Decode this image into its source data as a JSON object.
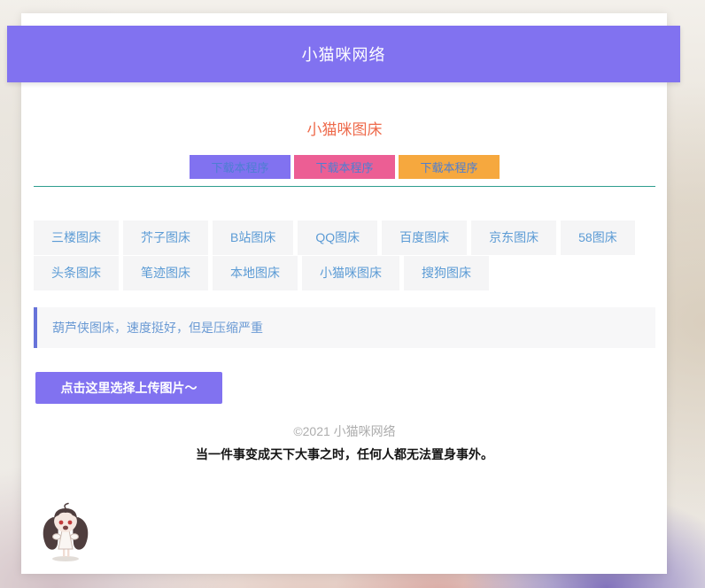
{
  "header": {
    "title": "小猫咪网络"
  },
  "main": {
    "title": "小猫咪图床",
    "download_buttons": [
      {
        "label": "下载本程序",
        "bg": "#8172f0"
      },
      {
        "label": "下载本程序",
        "bg": "#ec5e94"
      },
      {
        "label": "下载本程序",
        "bg": "#f6a83e"
      }
    ],
    "tabs": [
      "三楼图床",
      "芥子图床",
      "B站图床",
      "QQ图床",
      "百度图床",
      "京东图床",
      "58图床",
      "头条图床",
      "笔迹图床",
      "本地图床",
      "小猫咪图床",
      "搜狗图床"
    ],
    "notice": "葫芦侠图床，速度挺好，但是压缩严重",
    "upload_button": "点击这里选择上传图片～"
  },
  "footer": {
    "copyright": "©2021 小猫咪网络",
    "quote": "当一件事变成天下大事之时，任何人都无法置身事外。"
  },
  "mascot": {
    "name": "chibi-anime-girl-with-twintails"
  },
  "colors": {
    "banner": "#8172f0",
    "page_title": "#ee6a4b",
    "divider": "#2e9d8e",
    "tab_text": "#5b9bd5",
    "tab_bg": "#f5f5f6",
    "notice_border": "#6773d9",
    "notice_text": "#6a9ad4",
    "upload_bg": "#8172f0",
    "button_text": "#4d7ed2"
  }
}
